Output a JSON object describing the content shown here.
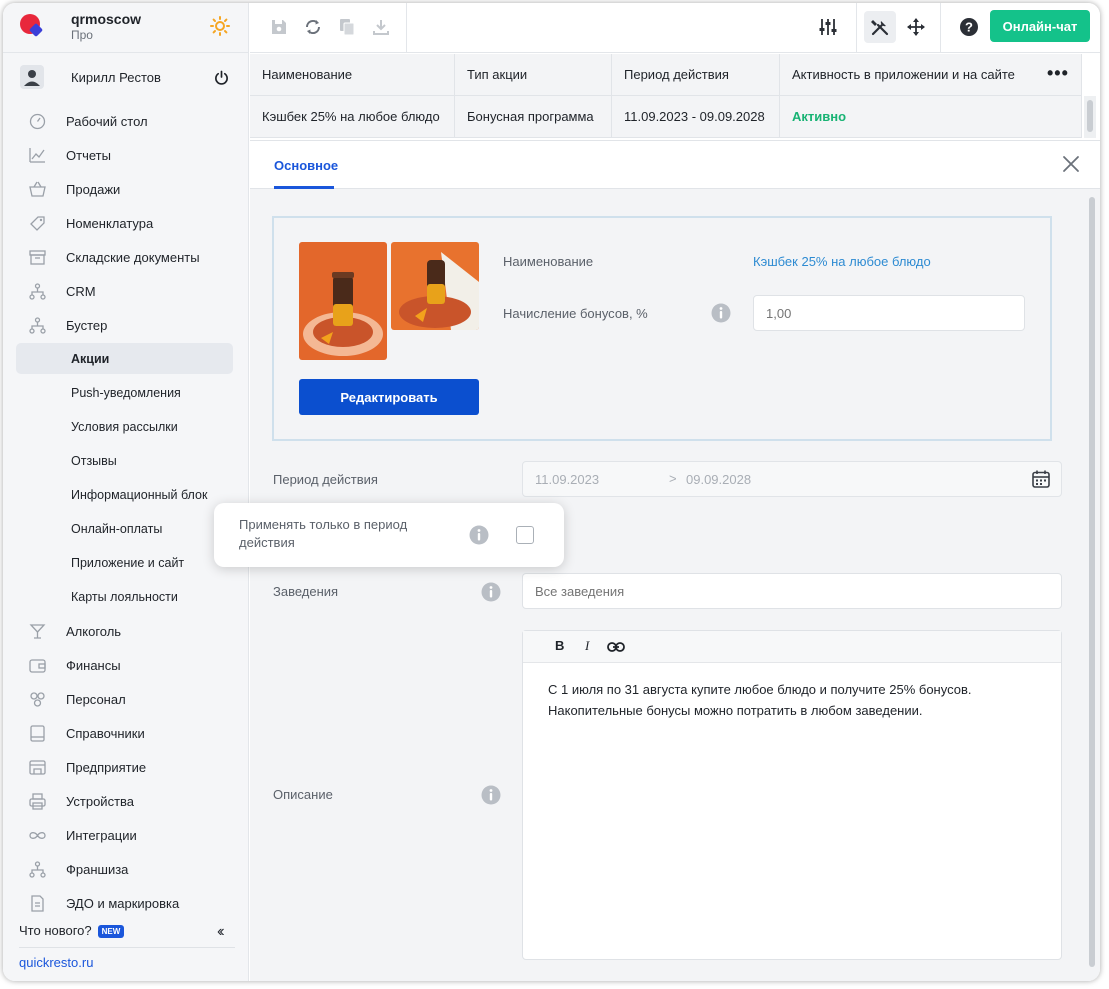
{
  "app": {
    "name": "qrmoscow",
    "plan": "Про"
  },
  "user": {
    "name": "Кирилл Рестов"
  },
  "sidebar": {
    "items": [
      {
        "label": "Рабочий стол",
        "icon": "gauge-icon"
      },
      {
        "label": "Отчеты",
        "icon": "chart-icon"
      },
      {
        "label": "Продажи",
        "icon": "basket-icon"
      },
      {
        "label": "Номенклатура",
        "icon": "tag-icon"
      },
      {
        "label": "Складские документы",
        "icon": "archive-icon"
      },
      {
        "label": "CRM",
        "icon": "hierarchy-icon"
      },
      {
        "label": "Бустер",
        "icon": "hierarchy-icon"
      }
    ],
    "subitems": [
      {
        "label": "Акции",
        "active": true
      },
      {
        "label": "Push-уведомления"
      },
      {
        "label": "Условия рассылки"
      },
      {
        "label": "Отзывы"
      },
      {
        "label": "Информационный блок"
      },
      {
        "label": "Онлайн-оплаты"
      },
      {
        "label": "Приложение и сайт"
      },
      {
        "label": "Карты лояльности"
      }
    ],
    "items2": [
      {
        "label": "Алкоголь",
        "icon": "glass-icon"
      },
      {
        "label": "Финансы",
        "icon": "wallet-icon"
      },
      {
        "label": "Персонал",
        "icon": "people-icon"
      },
      {
        "label": "Справочники",
        "icon": "book-icon"
      },
      {
        "label": "Предприятие",
        "icon": "store-icon"
      },
      {
        "label": "Устройства",
        "icon": "printer-icon"
      },
      {
        "label": "Интеграции",
        "icon": "infinity-icon"
      },
      {
        "label": "Франшиза",
        "icon": "hierarchy-icon"
      },
      {
        "label": "ЭДО и маркировка",
        "icon": "document-icon"
      }
    ],
    "whats_new": "Что нового?",
    "new_badge": "NEW",
    "site_link": "quickresto.ru"
  },
  "toolbar": {
    "chat_label": "Онлайн-чат"
  },
  "table": {
    "headers": [
      "Наименование",
      "Тип акции",
      "Период действия",
      "Активность в приложении и на сайте"
    ],
    "row": [
      "Кэшбек 25% на любое блюдо",
      "Бонусная программа",
      "11.09.2023 - 09.09.2028",
      "Активно"
    ]
  },
  "panel": {
    "tab_main": "Основное",
    "edit_button": "Редактировать",
    "name_label": "Наименование",
    "name_value": "Кэшбек 25% на любое блюдо",
    "bonus_label": "Начисление бонусов, %",
    "bonus_placeholder": "1,00",
    "period_label": "Период действия",
    "date_from": "11.09.2023",
    "date_arrow": ">",
    "date_to": "09.09.2028",
    "popup_label": "Применять только в период действия",
    "venues_label": "Заведения",
    "venues_placeholder": "Все заведения",
    "description_label": "Описание",
    "editor_bold": "B",
    "editor_italic": "I",
    "description_line1": "С 1 июля по 31 августа купите любое блюдо и получите 25% бонусов.",
    "description_line2": "Накопительные бонусы можно потратить в любом заведении."
  },
  "colors": {
    "accent": "#1a56db",
    "edit_button": "#0b4fcf",
    "chat_button": "#14c28a",
    "active_status": "#18b374",
    "link": "#2e8bd2"
  }
}
